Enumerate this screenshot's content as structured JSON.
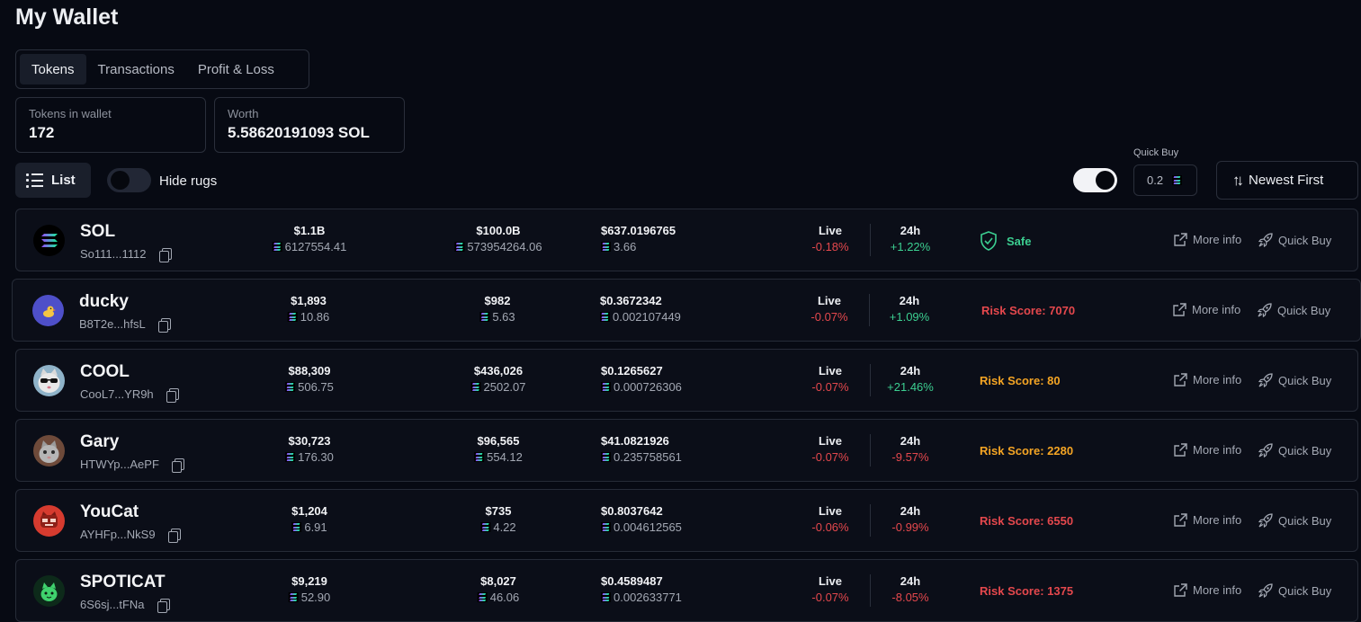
{
  "page": {
    "title": "My Wallet"
  },
  "tabs": [
    {
      "label": "Tokens",
      "active": true
    },
    {
      "label": "Transactions",
      "active": false
    },
    {
      "label": "Profit & Loss",
      "active": false
    }
  ],
  "stats": {
    "tokens_label": "Tokens in wallet",
    "tokens_value": "172",
    "worth_label": "Worth",
    "worth_value": "5.58620191093 SOL"
  },
  "controls": {
    "list_label": "List",
    "hide_rugs_label": "Hide rugs",
    "hide_rugs_on": false,
    "quick_buy_toggle_on": true,
    "quick_buy_label": "Quick Buy",
    "quick_buy_value": "0.2",
    "sort_label": "Newest First"
  },
  "row_labels": {
    "live": "Live",
    "day": "24h",
    "more_info": "More info",
    "quick_buy": "Quick Buy",
    "safe": "Safe"
  },
  "colors": {
    "negative": "#e5484d",
    "positive": "#3ccf91",
    "risk_orange": "#f5a524"
  },
  "tokens": [
    {
      "name": "SOL",
      "address": "So111...1112",
      "avatar_icon": "solana-logo-icon",
      "value_usd": "$1.1B",
      "value_sol": "6127554.41",
      "liquidity_usd": "$100.0B",
      "liquidity_sol": "573954264.06",
      "price_usd": "$637.0196765",
      "price_sol": "3.66",
      "live_change": "-0.18%",
      "day_change": "+1.22%",
      "status": "Safe",
      "status_type": "safe"
    },
    {
      "name": "ducky",
      "address": "B8T2e...hfsL",
      "avatar_icon": "duck-icon",
      "value_usd": "$1,893",
      "value_sol": "10.86",
      "liquidity_usd": "$982",
      "liquidity_sol": "5.63",
      "price_usd": "$0.3672342",
      "price_sol": "0.002107449",
      "live_change": "-0.07%",
      "day_change": "+1.09%",
      "status": "Risk Score: 7070",
      "status_type": "red"
    },
    {
      "name": "COOL",
      "address": "CooL7...YR9h",
      "avatar_icon": "cool-cat-icon",
      "value_usd": "$88,309",
      "value_sol": "506.75",
      "liquidity_usd": "$436,026",
      "liquidity_sol": "2502.07",
      "price_usd": "$0.1265627",
      "price_sol": "0.000726306",
      "live_change": "-0.07%",
      "day_change": "+21.46%",
      "status": "Risk Score: 80",
      "status_type": "orange"
    },
    {
      "name": "Gary",
      "address": "HTWYp...AePF",
      "avatar_icon": "gary-cat-icon",
      "value_usd": "$30,723",
      "value_sol": "176.30",
      "liquidity_usd": "$96,565",
      "liquidity_sol": "554.12",
      "price_usd": "$41.0821926",
      "price_sol": "0.235758561",
      "live_change": "-0.07%",
      "day_change": "-9.57%",
      "status": "Risk Score: 2280",
      "status_type": "orange"
    },
    {
      "name": "YouCat",
      "address": "AYHFp...NkS9",
      "avatar_icon": "red-cat-icon",
      "value_usd": "$1,204",
      "value_sol": "6.91",
      "liquidity_usd": "$735",
      "liquidity_sol": "4.22",
      "price_usd": "$0.8037642",
      "price_sol": "0.004612565",
      "live_change": "-0.06%",
      "day_change": "-0.99%",
      "status": "Risk Score: 6550",
      "status_type": "red"
    },
    {
      "name": "SPOTICAT",
      "address": "6S6sj...tFNa",
      "avatar_icon": "green-cat-icon",
      "value_usd": "$9,219",
      "value_sol": "52.90",
      "liquidity_usd": "$8,027",
      "liquidity_sol": "46.06",
      "price_usd": "$0.4589487",
      "price_sol": "0.002633771",
      "live_change": "-0.07%",
      "day_change": "-8.05%",
      "status": "Risk Score: 1375",
      "status_type": "red"
    }
  ]
}
